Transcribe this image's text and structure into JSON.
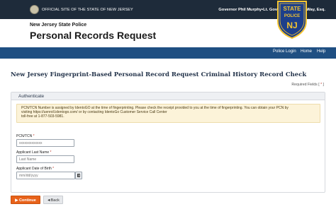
{
  "topbar": {
    "official_text": "OFFICIAL SITE OF THE STATE OF NEW JERSEY",
    "governor_text": "Governor Phil Murphy•Lt. Governor Tahesha Way, Esq."
  },
  "header": {
    "agency": "New Jersey State Police",
    "title": "Personal Records Request",
    "badge": {
      "top": "STATE",
      "middle": "POLICE",
      "bottom": "NJ"
    }
  },
  "nav": {
    "items": [
      {
        "label": "Police Login"
      },
      {
        "label": "Home"
      },
      {
        "label": "Help"
      }
    ]
  },
  "page": {
    "title": "New Jersey Fingerprint-Based Personal Record Request Criminal History Record Check",
    "required_prefix": "Required Fields [ ",
    "required_star": "*",
    "required_suffix": " ]"
  },
  "panel": {
    "heading": "Authenticate",
    "notice_line1": "PCN/TCN Number is assigned by IdentoGO at the time of fingerprinting. Please check the receipt provided to you at the time of fingerprinting. You can obtain your PCN by",
    "notice_line2": "visiting https://uenroll.identogo.com/ or by contacting IdentoGo Customer Service Call Center",
    "notice_line3": "toll-free at 1-877-503-5981."
  },
  "form": {
    "pcn_label": "PCN/TCN",
    "pcn_placeholder": "xxxxxxxxxxxxx",
    "lastname_label": "Applicant Last Name",
    "lastname_placeholder": "Last Name",
    "dob_label": "Applicant Date of Birth",
    "dob_placeholder": "mm/dd/yyyy",
    "required_mark": "*"
  },
  "buttons": {
    "continue": "▶ Continue",
    "back": "◄Back"
  },
  "colors": {
    "topbar": "#1e2b3a",
    "navbar": "#1f4f82",
    "continue": "#e8621a",
    "notice_bg": "#fcf3d9"
  }
}
